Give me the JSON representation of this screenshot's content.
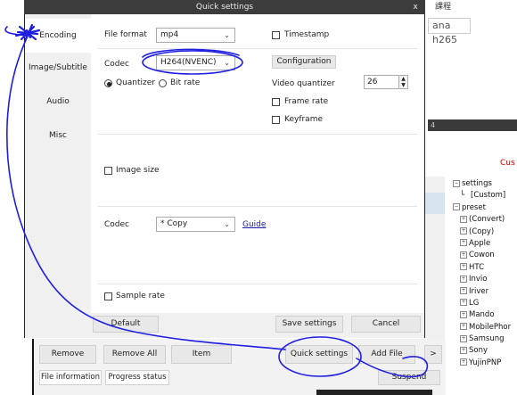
{
  "background": {
    "text_top": "課程",
    "text_box": "ana h265",
    "dark_strip": "4",
    "custom_label": "Cus",
    "tree": [
      {
        "label": "settings",
        "level": 0,
        "expander": "−"
      },
      {
        "label": "[Custom]",
        "level": 1,
        "expander": ""
      },
      {
        "label": "preset",
        "level": 0,
        "expander": "−"
      },
      {
        "label": "(Convert)",
        "level": 1,
        "expander": "+"
      },
      {
        "label": "(Copy)",
        "level": 1,
        "expander": "+"
      },
      {
        "label": "Apple",
        "level": 1,
        "expander": "+"
      },
      {
        "label": "Cowon",
        "level": 1,
        "expander": "+"
      },
      {
        "label": "HTC",
        "level": 1,
        "expander": "+"
      },
      {
        "label": "Invio",
        "level": 1,
        "expander": "+"
      },
      {
        "label": "Iriver",
        "level": 1,
        "expander": "+"
      },
      {
        "label": "LG",
        "level": 1,
        "expander": "+"
      },
      {
        "label": "Mando",
        "level": 1,
        "expander": "+"
      },
      {
        "label": "MobilePhor",
        "level": 1,
        "expander": "+"
      },
      {
        "label": "Samsung",
        "level": 1,
        "expander": "+"
      },
      {
        "label": "Sony",
        "level": 1,
        "expander": "+"
      },
      {
        "label": "YujinPNP",
        "level": 1,
        "expander": "+"
      }
    ],
    "buttons": {
      "remove": "Remove",
      "remove_all": "Remove All",
      "item": "Item",
      "quick_settings": "Quick settings",
      "add_file": "Add File",
      "more": ">"
    },
    "tabs": {
      "file_information": "File information",
      "progress_status": "Progress status"
    },
    "suspend": "Suspend"
  },
  "dialog": {
    "title": "Quick settings",
    "close": "x",
    "sidebar": [
      "Encoding",
      "Image/Subtitle",
      "Audio",
      "Misc"
    ],
    "active_tab": "Encoding",
    "file_format_label": "File format",
    "file_format_value": "mp4",
    "timestamp_label": "Timestamp",
    "timestamp_checked": false,
    "video_codec_label": "Codec",
    "video_codec_value": "H264(NVENC)",
    "configuration_button": "Configuration",
    "quantizer_label": "Quantizer",
    "quantizer_selected": true,
    "bitrate_label": "Bit rate",
    "video_quantizer_label": "Video quantizer",
    "video_quantizer_value": "26",
    "frame_rate_label": "Frame rate",
    "keyframe_label": "Keyframe",
    "image_size_label": "Image size",
    "audio_codec_label": "Codec",
    "audio_codec_value": "* Copy",
    "guide_link": "Guide",
    "sample_rate_label": "Sample rate",
    "default_button": "Default",
    "save_settings_button": "Save settings",
    "cancel_button": "Cancel"
  },
  "annotation_color": "#1f1fe0"
}
